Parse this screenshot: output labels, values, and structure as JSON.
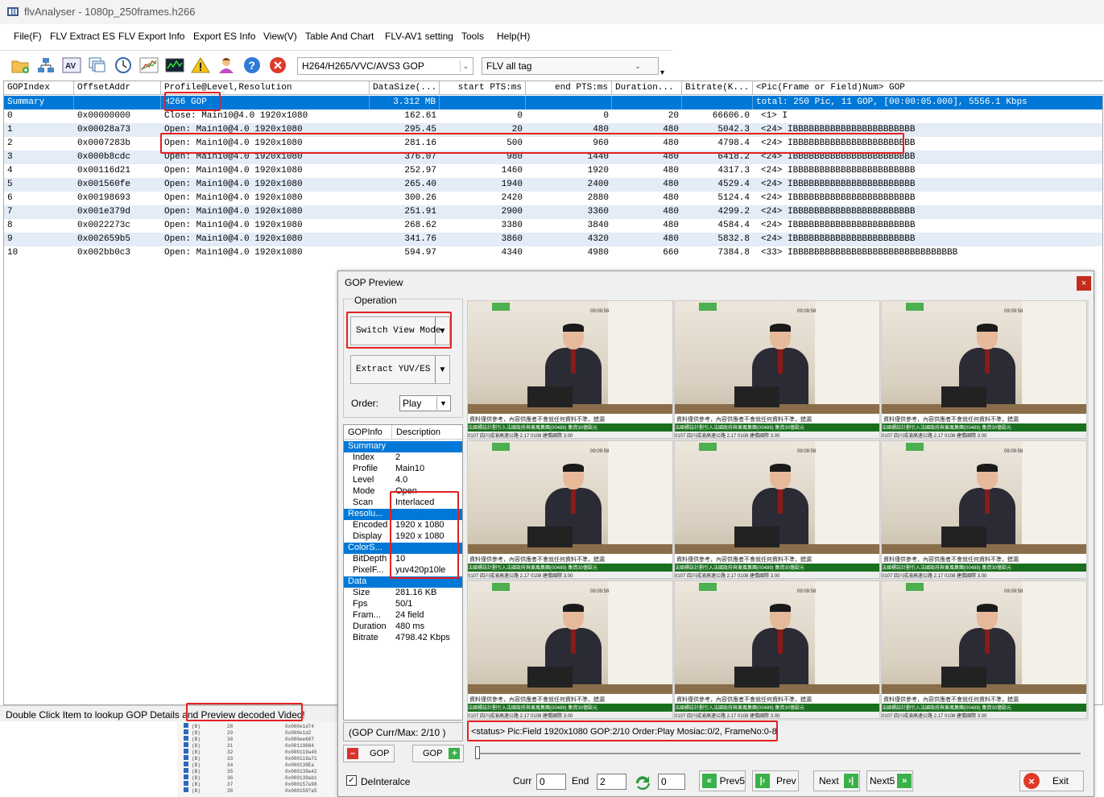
{
  "window": {
    "title": "flvAnalyser - 1080p_250frames.h266"
  },
  "menu": [
    "File(F)",
    "FLV Extract ES",
    "FLV Export Info",
    "Export ES Info",
    "View(V)",
    "Table And Chart",
    "FLV-AV1 setting",
    "Tools",
    "Help(H)"
  ],
  "toolbar": {
    "icons": [
      "open-folder-icon",
      "network-icon",
      "av-icon",
      "windows-icon",
      "clock-icon",
      "line-chart-icon",
      "bitrate-monitor-icon",
      "warning-icon",
      "user-icon",
      "help-icon",
      "close-red-icon"
    ],
    "gop_combo": "H264/H265/VVC/AVS3 GOP",
    "tag_combo": "FLV all tag"
  },
  "grid": {
    "columns": [
      "GOPIndex",
      "OffsetAddr",
      "Profile@Level,Resolution",
      "DataSize(...",
      "start PTS:ms",
      "end PTS:ms",
      "Duration...",
      "Bitrate(K...",
      "<Pic(Frame or Field)Num> GOP"
    ],
    "summary": {
      "index": "Summary",
      "profile": "H266 GOP",
      "size": "3.312 MB",
      "gop": "total: 250 Pic, 11 GOP, [00:00:05.000], 5556.1 Kbps"
    },
    "rows": [
      {
        "index": "0",
        "offset": "0x00000000",
        "profile": "Close: Main10@4.0  1920x1080",
        "size": "162.61",
        "start": "0",
        "end": "0",
        "duration": "20",
        "bitrate": "66606.0",
        "gop": "<1> I"
      },
      {
        "index": "1",
        "offset": "0x00028a73",
        "profile": "Open: Main10@4.0  1920x1080",
        "size": "295.45",
        "start": "20",
        "end": "480",
        "duration": "480",
        "bitrate": "5042.3",
        "gop": "<24> IBBBBBBBBBBBBBBBBBBBBBBB"
      },
      {
        "index": "2",
        "offset": "0x0007283b",
        "profile": "Open: Main10@4.0  1920x1080",
        "size": "281.16",
        "start": "500",
        "end": "960",
        "duration": "480",
        "bitrate": "4798.4",
        "gop": "<24> IBBBBBBBBBBBBBBBBBBBBBBB"
      },
      {
        "index": "3",
        "offset": "0x000b8cdc",
        "profile": "Open: Main10@4.0  1920x1080",
        "size": "376.07",
        "start": "980",
        "end": "1440",
        "duration": "480",
        "bitrate": "6418.2",
        "gop": "<24> IBBBBBBBBBBBBBBBBBBBBBBB"
      },
      {
        "index": "4",
        "offset": "0x00116d21",
        "profile": "Open: Main10@4.0  1920x1080",
        "size": "252.97",
        "start": "1460",
        "end": "1920",
        "duration": "480",
        "bitrate": "4317.3",
        "gop": "<24> IBBBBBBBBBBBBBBBBBBBBBBB"
      },
      {
        "index": "5",
        "offset": "0x001560fe",
        "profile": "Open: Main10@4.0  1920x1080",
        "size": "265.40",
        "start": "1940",
        "end": "2400",
        "duration": "480",
        "bitrate": "4529.4",
        "gop": "<24> IBBBBBBBBBBBBBBBBBBBBBBB"
      },
      {
        "index": "6",
        "offset": "0x00198693",
        "profile": "Open: Main10@4.0  1920x1080",
        "size": "300.26",
        "start": "2420",
        "end": "2880",
        "duration": "480",
        "bitrate": "5124.4",
        "gop": "<24> IBBBBBBBBBBBBBBBBBBBBBBB"
      },
      {
        "index": "7",
        "offset": "0x001e379d",
        "profile": "Open: Main10@4.0  1920x1080",
        "size": "251.91",
        "start": "2900",
        "end": "3360",
        "duration": "480",
        "bitrate": "4299.2",
        "gop": "<24> IBBBBBBBBBBBBBBBBBBBBBBB"
      },
      {
        "index": "8",
        "offset": "0x0022273c",
        "profile": "Open: Main10@4.0  1920x1080",
        "size": "268.62",
        "start": "3380",
        "end": "3840",
        "duration": "480",
        "bitrate": "4584.4",
        "gop": "<24> IBBBBBBBBBBBBBBBBBBBBBBB"
      },
      {
        "index": "9",
        "offset": "0x002659b5",
        "profile": "Open: Main10@4.0  1920x1080",
        "size": "341.76",
        "start": "3860",
        "end": "4320",
        "duration": "480",
        "bitrate": "5832.8",
        "gop": "<24> IBBBBBBBBBBBBBBBBBBBBBBB"
      },
      {
        "index": "10",
        "offset": "0x002bb0c3",
        "profile": "Open: Main10@4.0  1920x1080",
        "size": "594.97",
        "start": "4340",
        "end": "4980",
        "duration": "660",
        "bitrate": "7384.8",
        "gop": "<33> IBBBBBBBBBBBBBBBBBBBBBBBBBBBBBBB"
      }
    ]
  },
  "status": {
    "text": "Double Click Item to lookup GOP Details and Preview decoded Video!"
  },
  "bg_list": [
    [
      "(B)",
      "28",
      "0x000e1d74"
    ],
    [
      "(B)",
      "29",
      "0x000e1d2"
    ],
    [
      "(B)",
      "30",
      "0x000ee607"
    ],
    [
      "(B)",
      "31",
      "0x00119684"
    ],
    [
      "(B)",
      "32",
      "0x000119a45"
    ],
    [
      "(B)",
      "33",
      "0x000119a71"
    ],
    [
      "(B)",
      "34",
      "0x000139Ea"
    ],
    [
      "(B)",
      "35",
      "0x000139a42"
    ],
    [
      "(B)",
      "36",
      "0x000139ab1"
    ],
    [
      "(B)",
      "37",
      "0x000157a98"
    ],
    [
      "(B)",
      "38",
      "0x000158?a5"
    ]
  ],
  "gop_preview": {
    "title": "GOP Preview",
    "close": "×",
    "operation_label": "Operation",
    "switch_view": "Switch View Mode",
    "extract": "Extract YUV/ES",
    "order_label": "Order:",
    "order_value": "Play",
    "info_headers": [
      "GOPInfo",
      "Description"
    ],
    "info": [
      {
        "section": "Summary"
      },
      {
        "k": "Index",
        "v": "2"
      },
      {
        "k": "Profile",
        "v": "Main10"
      },
      {
        "k": "Level",
        "v": "4.0"
      },
      {
        "k": "Mode",
        "v": "Open"
      },
      {
        "k": "Scan",
        "v": "Interlaced"
      },
      {
        "section": "Resolu..."
      },
      {
        "k": "Encoded",
        "v": "1920 x 1080"
      },
      {
        "k": "Display",
        "v": "1920 x 1080"
      },
      {
        "section": "ColorS..."
      },
      {
        "k": "BitDepth",
        "v": "10"
      },
      {
        "k": "PixelF...",
        "v": "yuv420p10le"
      },
      {
        "section": "Data"
      },
      {
        "k": "Size",
        "v": "281.16 KB"
      },
      {
        "k": "Fps",
        "v": "50/1"
      },
      {
        "k": "Fram...",
        "v": "24 field"
      },
      {
        "k": "Duration",
        "v": "480 ms"
      },
      {
        "k": "Bitrate",
        "v": "4798.42 Kbps"
      }
    ],
    "gop_curmax": "(GOP Curr/Max:  2/10 )",
    "gop_prev": "GOP",
    "gop_next": "GOP",
    "frame_status": "<status> Pic:Field  1920x1080  GOP:2/10 Order:Play Mosiac:0/2, FrameNo:0-8",
    "ticker_top": "資料僅供參考，內容供應者不會就任何資料不準，錯漏",
    "ticker_mid": "法國標誌計劃引入法國政府與東風集團(00489)  集資30億歐元",
    "ticker_bot": "0107 四川成渝高速公路 2.17  0108 建僑國際 3.00",
    "clock": "09:09:58",
    "deinterlace": "DeInteralce",
    "curr_label": "Curr",
    "curr_value": "0",
    "end_label": "End",
    "end_value": "2",
    "goto_value": "0",
    "prev5": "Prev5",
    "prev": "Prev",
    "next": "Next",
    "next5": "Next5",
    "exit": "Exit"
  }
}
